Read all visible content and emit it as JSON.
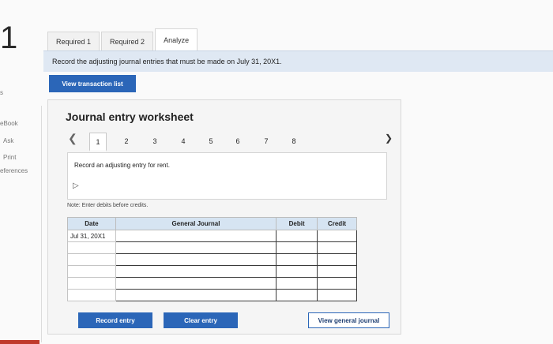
{
  "question_number": "1",
  "left_sidebar": {
    "fragments": [
      "s",
      "eBook",
      "Ask",
      "Print",
      "eferences"
    ]
  },
  "tabs": [
    {
      "label": "Required 1"
    },
    {
      "label": "Required 2"
    },
    {
      "label": "Analyze"
    }
  ],
  "instruction": "Record the adjusting journal entries that must be made on July 31, 20X1.",
  "view_transaction_label": "View transaction list",
  "worksheet": {
    "title": "Journal entry worksheet",
    "pages": [
      "1",
      "2",
      "3",
      "4",
      "5",
      "6",
      "7",
      "8"
    ],
    "active_page": "1",
    "entry_instruction": "Record an adjusting entry for rent.",
    "note": "Note: Enter debits before credits.",
    "columns": {
      "date": "Date",
      "account": "General Journal",
      "debit": "Debit",
      "credit": "Credit"
    },
    "rows": [
      {
        "date": "Jul 31, 20X1",
        "account": "",
        "debit": "",
        "credit": ""
      },
      {
        "date": "",
        "account": "",
        "debit": "",
        "credit": ""
      },
      {
        "date": "",
        "account": "",
        "debit": "",
        "credit": ""
      },
      {
        "date": "",
        "account": "",
        "debit": "",
        "credit": ""
      },
      {
        "date": "",
        "account": "",
        "debit": "",
        "credit": ""
      },
      {
        "date": "",
        "account": "",
        "debit": "",
        "credit": ""
      }
    ],
    "buttons": {
      "record": "Record entry",
      "clear": "Clear entry",
      "view_journal": "View general journal"
    }
  },
  "colors": {
    "accent": "#2b66b8",
    "instruction_bg": "#dfe8f3",
    "header_bg": "#d6e4f2"
  }
}
